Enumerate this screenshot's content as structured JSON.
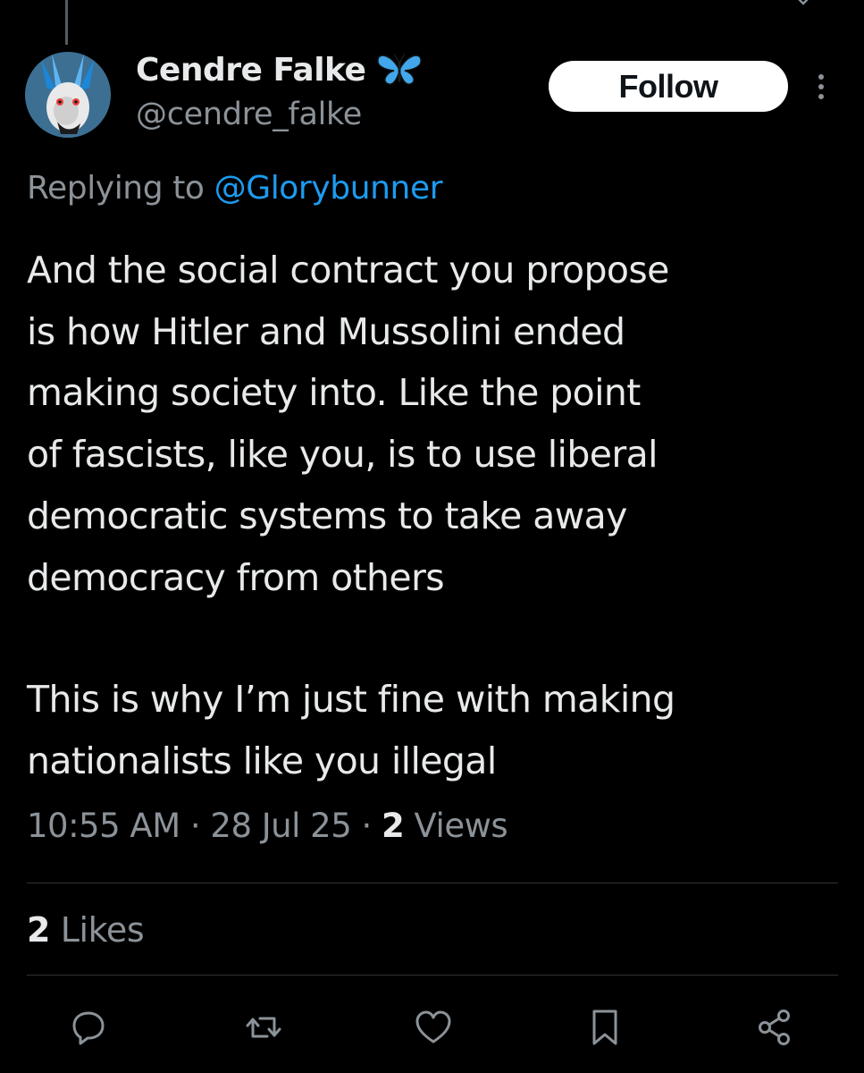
{
  "author": {
    "display_name": "Cendre Falke",
    "handle": "@cendre_falke",
    "verified_badge_icon": "butterfly-emoji"
  },
  "follow_label": "Follow",
  "reply": {
    "prefix": "Replying to ",
    "mention": "@Glorybunner"
  },
  "tweet": {
    "paragraph_1": "And the social contract you propose\nis how Hitler and Mussolini ended\nmaking society into. Like the point\nof fascists, like you, is to use liberal\ndemocratic systems to take away\ndemocracy from others",
    "paragraph_2": "This is why I’m just fine with making\nnationalists like you illegal"
  },
  "meta": {
    "time": "10:55 AM",
    "separator": " · ",
    "date": "28 Jul 25",
    "views_count": "2",
    "views_label": " Views"
  },
  "stats": {
    "likes_count": "2",
    "likes_label": " Likes"
  },
  "actions": [
    "reply-icon",
    "retweet-icon",
    "like-icon",
    "bookmark-icon",
    "share-icon"
  ],
  "colors": {
    "background": "#000000",
    "text": "#e7e9ea",
    "muted": "#8b9298",
    "accent": "#1d9bf0",
    "divider": "#2f3336"
  }
}
